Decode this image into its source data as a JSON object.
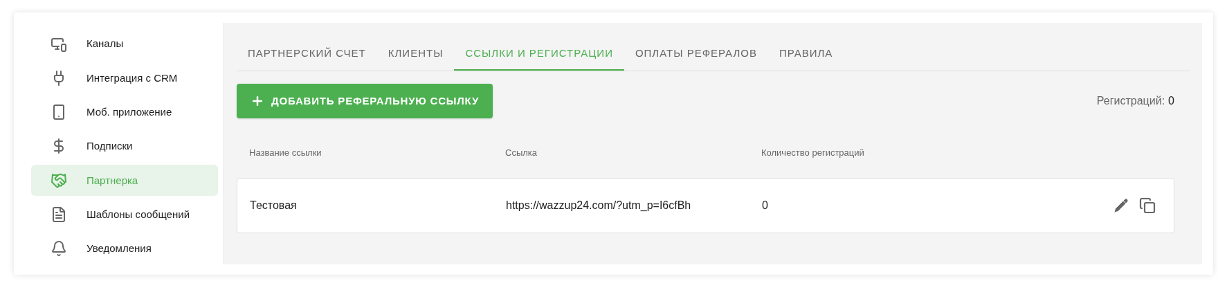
{
  "sidebar": {
    "items": [
      {
        "label": "Каналы",
        "selected": false
      },
      {
        "label": "Интеграция с CRM",
        "selected": false
      },
      {
        "label": "Моб. приложение",
        "selected": false
      },
      {
        "label": "Подписки",
        "selected": false
      },
      {
        "label": "Партнерка",
        "selected": true
      },
      {
        "label": "Шаблоны сообщений",
        "selected": false
      },
      {
        "label": "Уведомления",
        "selected": false
      }
    ]
  },
  "tabs": [
    {
      "label": "ПАРТНЕРСКИЙ СЧЕТ",
      "selected": false
    },
    {
      "label": "КЛИЕНТЫ",
      "selected": false
    },
    {
      "label": "ССЫЛКИ И РЕГИСТРАЦИИ",
      "selected": true
    },
    {
      "label": "ОПЛАТЫ РЕФЕРАЛОВ",
      "selected": false
    },
    {
      "label": "ПРАВИЛА",
      "selected": false
    }
  ],
  "add_button": {
    "label": "ДОБАВИТЬ РЕФЕРАЛЬНУЮ ССЫЛКУ"
  },
  "registrations": {
    "label": "Регистраций:",
    "value": "0"
  },
  "table": {
    "columns": [
      "Название ссылки",
      "Ссылка",
      "Количество регистраций"
    ],
    "rows": [
      {
        "name": "Тестовая",
        "link": "https://wazzup24.com/?utm_p=I6cfBh",
        "count": "0"
      }
    ]
  }
}
